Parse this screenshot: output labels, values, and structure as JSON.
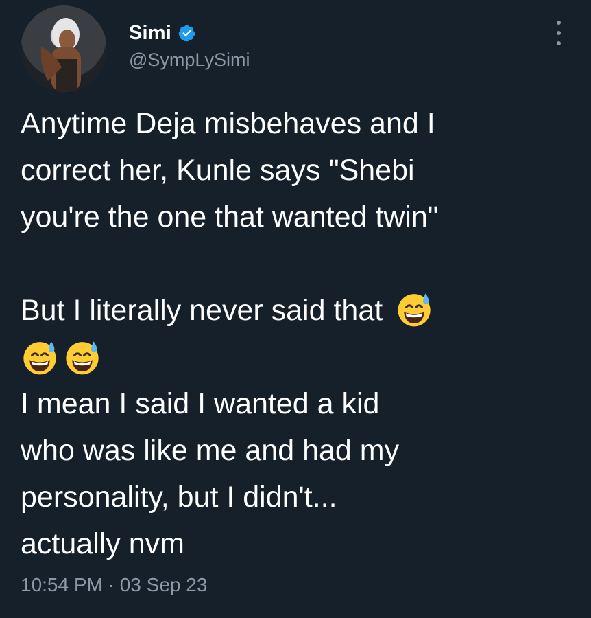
{
  "author": {
    "name": "Simi",
    "handle": "@SympLySimi",
    "verified": true,
    "avatar_icon": "profile-photo"
  },
  "tweet": {
    "lines_before_emoji": [
      "Anytime Deja misbehaves and I",
      "correct her, Kunle says \"Shebi",
      "you're the one that wanted twin\""
    ],
    "emoji_line_text": "But I literally never said that",
    "emoji_name": "grinning-face-with-sweat",
    "lines_after_emoji": [
      "I mean I said I wanted a kid",
      "who was like me and had my",
      "personality, but I didn't...",
      "actually nvm"
    ]
  },
  "timestamp": "10:54 PM · 03 Sep 23",
  "colors": {
    "background": "#15202b",
    "text": "#ffffff",
    "secondary_text": "#8b98a5",
    "verified_badge": "#1d9bf0"
  }
}
